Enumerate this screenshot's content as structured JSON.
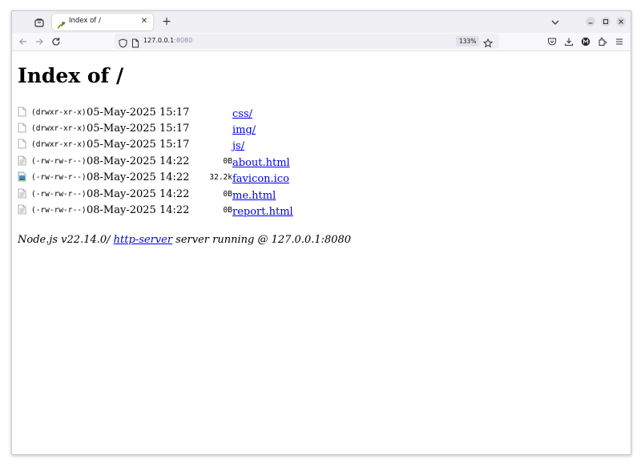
{
  "browser": {
    "tab": {
      "title": "Index of /"
    },
    "url": {
      "host": "127.0.0.1",
      "port": ":8080"
    },
    "zoom": "133%"
  },
  "page": {
    "title": "Index of /",
    "entries": [
      {
        "perms": "(drwxr-xr-x)",
        "date": "05-May-2025 15:17",
        "size": "",
        "name": "css/",
        "type": "dir"
      },
      {
        "perms": "(drwxr-xr-x)",
        "date": "05-May-2025 15:17",
        "size": "",
        "name": "img/",
        "type": "dir"
      },
      {
        "perms": "(drwxr-xr-x)",
        "date": "05-May-2025 15:17",
        "size": "",
        "name": "js/",
        "type": "dir"
      },
      {
        "perms": "(-rw-rw-r--)",
        "date": "08-May-2025 14:22",
        "size": "0B",
        "name": "about.html",
        "type": "html"
      },
      {
        "perms": "(-rw-rw-r--)",
        "date": "08-May-2025 14:22",
        "size": "32.2k",
        "name": "favicon.ico",
        "type": "image"
      },
      {
        "perms": "(-rw-rw-r--)",
        "date": "08-May-2025 14:22",
        "size": "0B",
        "name": "me.html",
        "type": "html"
      },
      {
        "perms": "(-rw-rw-r--)",
        "date": "08-May-2025 14:22",
        "size": "0B",
        "name": "report.html",
        "type": "html"
      }
    ],
    "footer": {
      "prefix": "Node.js v22.14.0/ ",
      "link": "http-server",
      "suffix": " server running @ 127.0.0.1:8080"
    }
  },
  "icons": {
    "dir": "blank-file-icon",
    "html": "html-file-icon",
    "image": "image-file-icon"
  }
}
